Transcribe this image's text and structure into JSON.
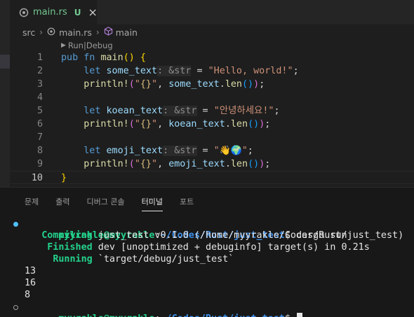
{
  "tab": {
    "filename": "main.rs",
    "status": "U",
    "close": "×"
  },
  "breadcrumb": {
    "folder": "src",
    "file": "main.rs",
    "symbol": "main"
  },
  "codelens": {
    "run": "Run",
    "sep": " | ",
    "debug": "Debug"
  },
  "line_numbers": [
    "1",
    "2",
    "3",
    "4",
    "5",
    "6",
    "7",
    "8",
    "9",
    "10"
  ],
  "code": {
    "l1": {
      "kw1": "pub",
      "kw2": "fn",
      "name": "main",
      "open": "()",
      "brace": "{"
    },
    "l2": {
      "kw": "let",
      "var": "some_text",
      "hint": ": &str",
      "eq": " = ",
      "str": "\"Hello, world!\"",
      "end": ";"
    },
    "l3": {
      "mac": "println!",
      "p1": "(",
      "s1": "\"",
      "esc": "{}",
      "s2": "\"",
      "comma": ", ",
      "var": "some_text",
      "dot": ".",
      "fn": "len",
      "call": "()",
      "p2": ")",
      "end": ";"
    },
    "l5": {
      "kw": "let",
      "var": "koean_text",
      "hint": ": &str",
      "eq": " = ",
      "str": "\"안녕하세요!\"",
      "end": ";"
    },
    "l6": {
      "mac": "println!",
      "p1": "(",
      "s1": "\"",
      "esc": "{}",
      "s2": "\"",
      "comma": ", ",
      "var": "koean_text",
      "dot": ".",
      "fn": "len",
      "call": "()",
      "p2": ")",
      "end": ";"
    },
    "l8": {
      "kw": "let",
      "var": "emoji_text",
      "hint": ": &str",
      "eq": " = ",
      "str": "\"👋🌍\"",
      "end": ";"
    },
    "l9": {
      "mac": "println!",
      "p1": "(",
      "s1": "\"",
      "esc": "{}",
      "s2": "\"",
      "comma": ", ",
      "var": "emoji_text",
      "dot": ".",
      "fn": "len",
      "call": "()",
      "p2": ")",
      "end": ";"
    },
    "l10": {
      "brace": "}"
    }
  },
  "panel_tabs": [
    "문제",
    "출력",
    "디버그 콘솔",
    "터미널",
    "포트"
  ],
  "panel_active": "터미널",
  "terminal": {
    "prompt_user": "myyrakle@myyrakle",
    "prompt_colon": ":",
    "prompt_path": "~/Codes/Rust/just_test",
    "prompt_dollar": "$ ",
    "command": "cargo run",
    "compiling_label": "Compiling",
    "compiling_text": " just_test v0.1.0 (/home/myyrakle/Codes/Rust/just_test)",
    "finished_label": "Finished",
    "finished_text": " dev [unoptimized + debuginfo] target(s) in 0.21s",
    "running_label": "Running",
    "running_text": " `target/debug/just_test`",
    "outputs": [
      "13",
      "16",
      "8"
    ]
  },
  "colors": {
    "accent": "#23d18b",
    "path": "#3b8eea",
    "modified": "#73c991"
  }
}
